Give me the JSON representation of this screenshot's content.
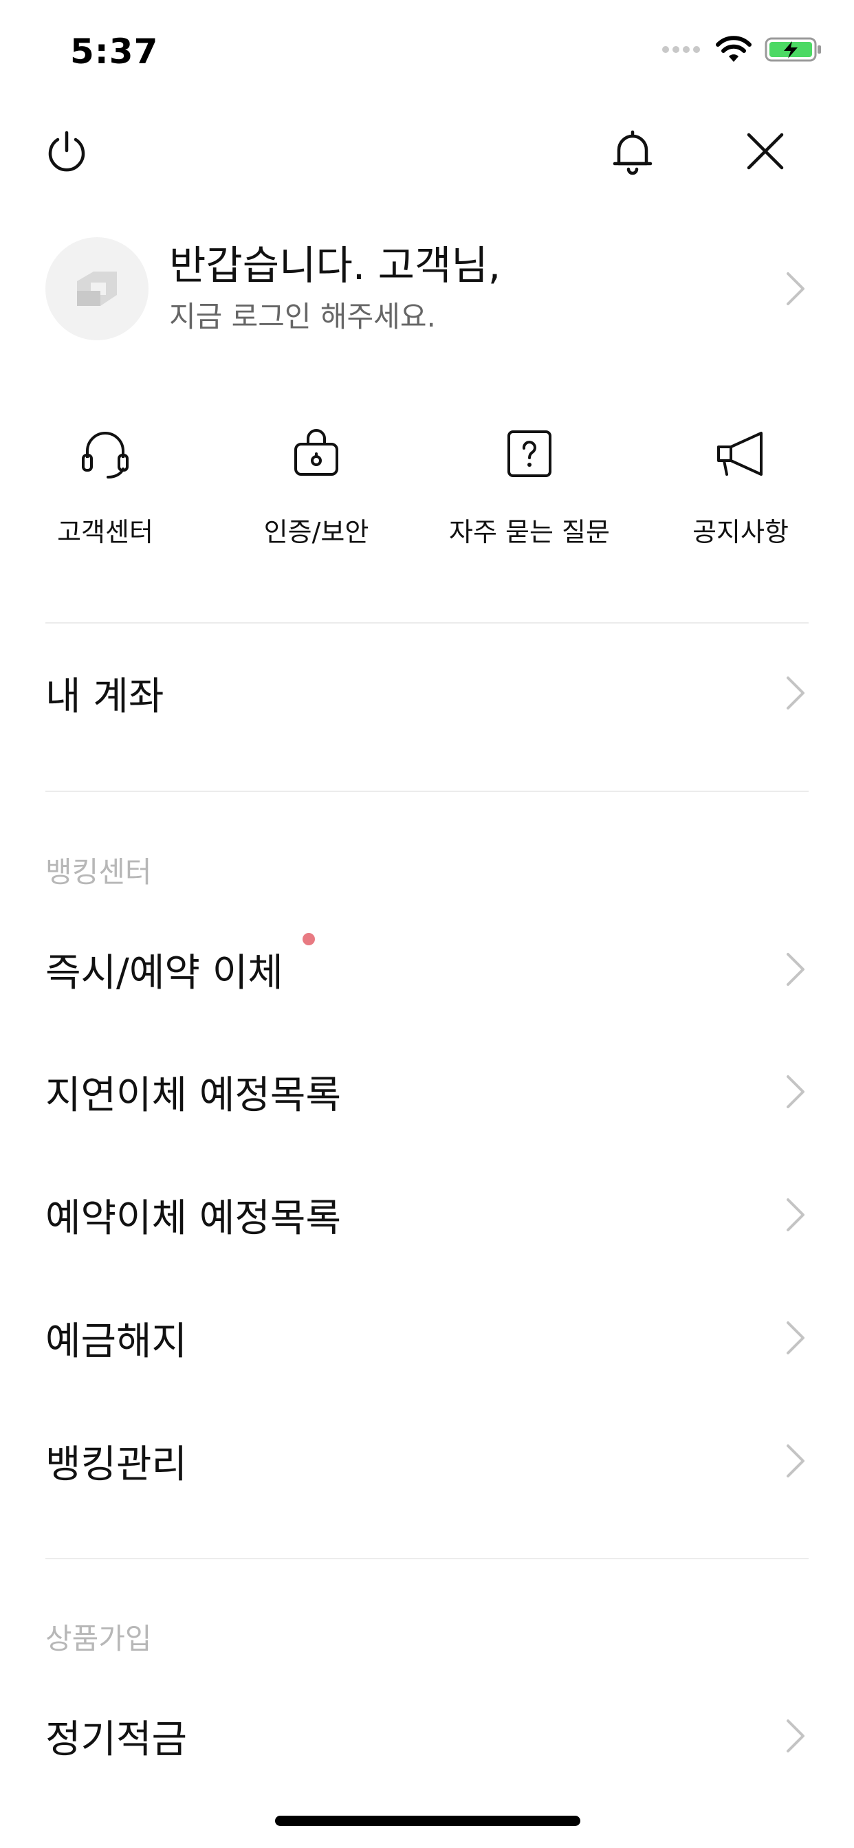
{
  "status_bar": {
    "time": "5:37"
  },
  "top_bar": {
    "power_icon": "power-icon",
    "bell_icon": "bell-icon",
    "close_icon": "close-icon"
  },
  "profile": {
    "greeting": "반갑습니다. 고객님,",
    "subtitle": "지금 로그인 해주세요."
  },
  "quick_menu": [
    {
      "label": "고객센터",
      "icon": "headset-icon"
    },
    {
      "label": "인증/보안",
      "icon": "lock-bag-icon"
    },
    {
      "label": "자주 묻는 질문",
      "icon": "question-icon"
    },
    {
      "label": "공지사항",
      "icon": "megaphone-icon"
    }
  ],
  "my_account": {
    "label": "내 계좌"
  },
  "banking_center": {
    "title": "뱅킹센터",
    "items": [
      {
        "label": "즉시/예약 이체",
        "new": true
      },
      {
        "label": "지연이체 예정목록"
      },
      {
        "label": "예약이체 예정목록"
      },
      {
        "label": "예금해지"
      },
      {
        "label": "뱅킹관리"
      }
    ]
  },
  "products": {
    "title": "상품가입",
    "items": [
      {
        "label": "정기적금"
      }
    ]
  },
  "colors": {
    "badge": "#e87a82",
    "section_title": "#b7b7b7",
    "chevron": "#c4c4c4"
  }
}
